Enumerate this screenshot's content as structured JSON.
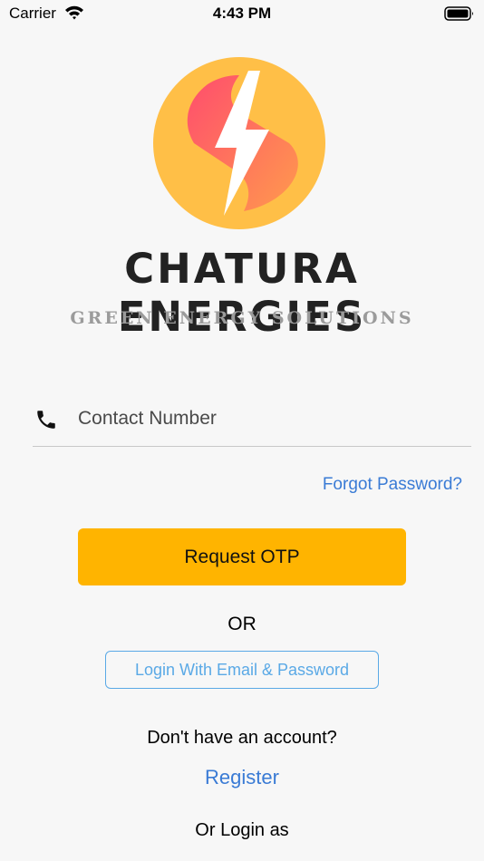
{
  "status_bar": {
    "carrier": "Carrier",
    "time": "4:43 PM"
  },
  "brand": {
    "name": "CHATURA ENERGIES",
    "tagline": "GREEN ENERGY SOLUTIONS"
  },
  "contact": {
    "placeholder": "Contact Number",
    "value": ""
  },
  "links": {
    "forgot_password": "Forgot Password?",
    "register": "Register"
  },
  "buttons": {
    "request_otp": "Request OTP",
    "login_email": "Login With Email & Password"
  },
  "text": {
    "or": "OR",
    "no_account": "Don't have an account?",
    "or_login_as": "Or Login as"
  },
  "colors": {
    "accent": "#ffb400",
    "link": "#3a7bd5",
    "outline_button": "#5aa9e6"
  }
}
